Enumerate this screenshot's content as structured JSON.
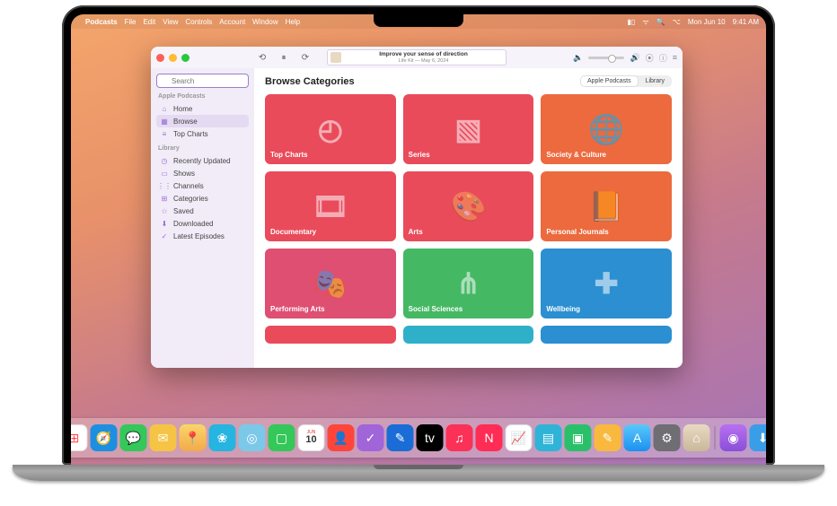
{
  "menubar": {
    "apple": "",
    "app": "Podcasts",
    "items": [
      "File",
      "Edit",
      "View",
      "Controls",
      "Account",
      "Window",
      "Help"
    ],
    "date": "Mon Jun 10",
    "time": "9:41 AM"
  },
  "player": {
    "now_playing_title": "Improve your sense of direction",
    "now_playing_sub": "Life Kit — May 6, 2024"
  },
  "search": {
    "placeholder": "Search"
  },
  "sidebar": {
    "section1": "Apple Podcasts",
    "items1": [
      {
        "icon": "⌂",
        "label": "Home"
      },
      {
        "icon": "▦",
        "label": "Browse"
      },
      {
        "icon": "≡",
        "label": "Top Charts"
      }
    ],
    "section2": "Library",
    "items2": [
      {
        "icon": "◷",
        "label": "Recently Updated"
      },
      {
        "icon": "▭",
        "label": "Shows"
      },
      {
        "icon": "⋮⋮",
        "label": "Channels"
      },
      {
        "icon": "⊞",
        "label": "Categories"
      },
      {
        "icon": "☆",
        "label": "Saved"
      },
      {
        "icon": "⬇",
        "label": "Downloaded"
      },
      {
        "icon": "✓",
        "label": "Latest Episodes"
      }
    ]
  },
  "main": {
    "title": "Browse Categories",
    "pills": [
      "Apple Podcasts",
      "Library"
    ],
    "active_pill": 0,
    "categories": [
      {
        "label": "Top Charts",
        "color": "c-red",
        "deco": "◴"
      },
      {
        "label": "Series",
        "color": "c-red",
        "deco": "▧"
      },
      {
        "label": "Society & Culture",
        "color": "c-orange",
        "deco": "🌐"
      },
      {
        "label": "Documentary",
        "color": "c-red",
        "deco": "🎞"
      },
      {
        "label": "Arts",
        "color": "c-red",
        "deco": "🎨"
      },
      {
        "label": "Personal Journals",
        "color": "c-orange",
        "deco": "📙"
      },
      {
        "label": "Performing Arts",
        "color": "c-pink",
        "deco": "🎭"
      },
      {
        "label": "Social Sciences",
        "color": "c-green",
        "deco": "⋔"
      },
      {
        "label": "Wellbeing",
        "color": "c-blue",
        "deco": "✚"
      }
    ],
    "peek": [
      "c-red",
      "c-cyan",
      "c-blue"
    ]
  },
  "dock": {
    "cal_month": "JUN",
    "cal_day": "10"
  }
}
